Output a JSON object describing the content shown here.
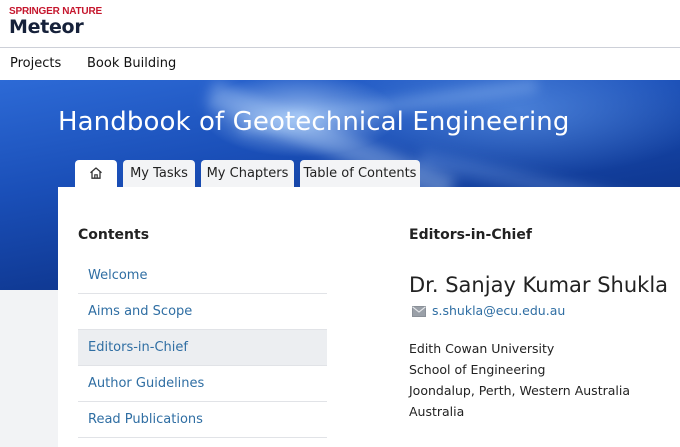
{
  "brand": {
    "publisher": "SPRINGER NATURE",
    "app": "Meteor"
  },
  "nav": {
    "items": [
      "Projects",
      "Book Building"
    ]
  },
  "book": {
    "title": "Handbook of Geotechnical Engineering"
  },
  "tabs": {
    "home_icon": "home-icon",
    "items": [
      "My Tasks",
      "My Chapters",
      "Table of Contents"
    ]
  },
  "contents": {
    "heading": "Contents",
    "items": [
      "Welcome",
      "Aims and Scope",
      "Editors-in-Chief",
      "Author Guidelines",
      "Read Publications"
    ],
    "active_index": 2
  },
  "editors": {
    "heading": "Editors-in-Chief",
    "name": "Dr. Sanjay Kumar Shukla",
    "email_icon": "envelope-icon",
    "email": "s.shukla@ecu.edu.au",
    "address": [
      "Edith Cowan University",
      "School of Engineering",
      "Joondalup, Perth, Western Australia",
      "Australia"
    ]
  },
  "colors": {
    "accent_red": "#c5162d",
    "link_blue": "#2f6ea3",
    "hero_blue": "#1a4fb8"
  }
}
